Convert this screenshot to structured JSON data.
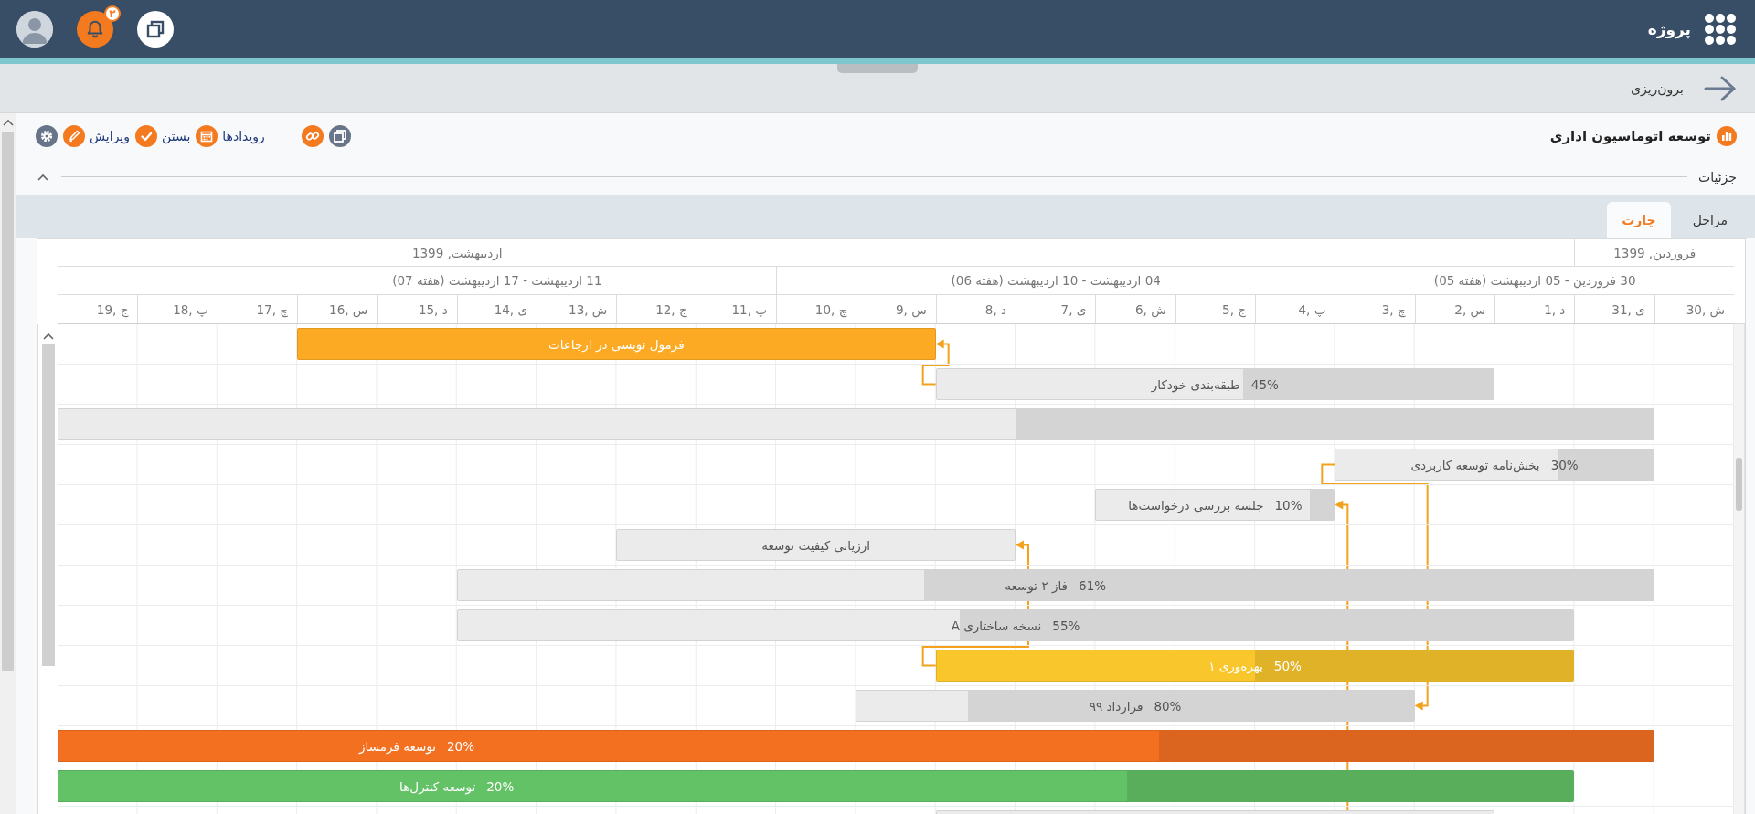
{
  "app": {
    "title": "پروژه",
    "notification_count": "۲"
  },
  "export": {
    "label": "برون‌ریزی"
  },
  "project": {
    "title": "توسعه اتوماسیون اداری"
  },
  "toolbar": [
    {
      "kind": "copy"
    },
    {
      "kind": "link"
    },
    {
      "kind": "events",
      "label": "رویدادها"
    },
    {
      "kind": "close",
      "label": "بستن"
    },
    {
      "kind": "edit",
      "label": "ویرایش"
    },
    {
      "kind": "settings"
    }
  ],
  "details": {
    "label": "جزئیات",
    "expanded": true
  },
  "tabs": [
    {
      "label": "مراحل",
      "selected": false
    },
    {
      "label": "چارت",
      "selected": true
    }
  ],
  "gantt": {
    "months": [
      {
        "label": "فروردین, 1399",
        "days": [
          {
            "label": "30, ش",
            "week_start": true
          },
          {
            "label": "31, ی",
            "week_start": false
          }
        ]
      },
      {
        "label": "اردیبهشت, 1399",
        "days": [
          {
            "label": "1, د",
            "week_start": false
          },
          {
            "label": "2, س",
            "week_start": false
          },
          {
            "label": "3, چ",
            "week_start": false
          },
          {
            "label": "4, پ",
            "week_start": true
          },
          {
            "label": "5, ج",
            "week_start": false
          },
          {
            "label": "6, ش",
            "week_start": false
          },
          {
            "label": "7, ی",
            "week_start": false
          },
          {
            "label": "8, د",
            "week_start": false
          },
          {
            "label": "9, س",
            "week_start": false
          },
          {
            "label": "10, چ",
            "week_start": false
          },
          {
            "label": "11, پ",
            "week_start": true
          },
          {
            "label": "12, ج",
            "week_start": false
          },
          {
            "label": "13, ش",
            "week_start": false
          },
          {
            "label": "14, ی",
            "week_start": false
          },
          {
            "label": "15, د",
            "week_start": false
          },
          {
            "label": "16, س",
            "week_start": false
          },
          {
            "label": "17, چ",
            "week_start": false
          },
          {
            "label": "18, پ",
            "week_start": true
          },
          {
            "label": "19, ج",
            "week_start": false
          }
        ]
      }
    ],
    "weeks": [
      {
        "label": "30 فروردین - 05 اردیبهشت (هفته 05)"
      },
      {
        "label": "04 اردیبهشت - 10 اردیبهشت (هفته 06)"
      },
      {
        "label": "11 اردیبهشت - 17 اردیبهشت (هفته 07)"
      }
    ],
    "tasks": [
      {
        "name": "فرمول نویسی در ارجاعات",
        "color": "#fca923"
      },
      {
        "name": "طبقه‌بندی خودکار",
        "percent": "45%",
        "color": "#ebebeb",
        "level": 0.45
      },
      {
        "color": "#ebebeb",
        "level": 0.4
      },
      {
        "name": "بخش‌نامه توسعه کاربردی",
        "percent": "30%",
        "color": "#ebebeb",
        "level": 0.3
      },
      {
        "name": "جلسه بررسی درخواست‌ها",
        "percent": "10%",
        "color": "#ebebeb",
        "level": 0.1
      },
      {
        "name": "ارزیابی کیفیت توسعه",
        "color": "#ebebeb"
      },
      {
        "name": "فاز ۲ توسعه",
        "percent": "61%",
        "color": "#ebebeb",
        "level": 0.61
      },
      {
        "name": "نسخه ساختاری A",
        "percent": "55%",
        "color": "#ebebeb",
        "level": 0.55
      },
      {
        "name": "بهره‌وری ۱",
        "percent": "50%",
        "color": "#f9c62b",
        "level": 0.5
      },
      {
        "name": "قرارداد ۹۹",
        "percent": "80%",
        "color": "#ebebeb",
        "level": 0.8
      },
      {
        "name": "توسعه فرمساز",
        "percent": "20%",
        "color": "#f37021",
        "level": 0.2
      },
      {
        "name": "توسعه کنترل‌ها",
        "percent": "20%",
        "color": "#63c166",
        "level": 0.2
      },
      {
        "color": "#ebebeb"
      }
    ]
  }
}
